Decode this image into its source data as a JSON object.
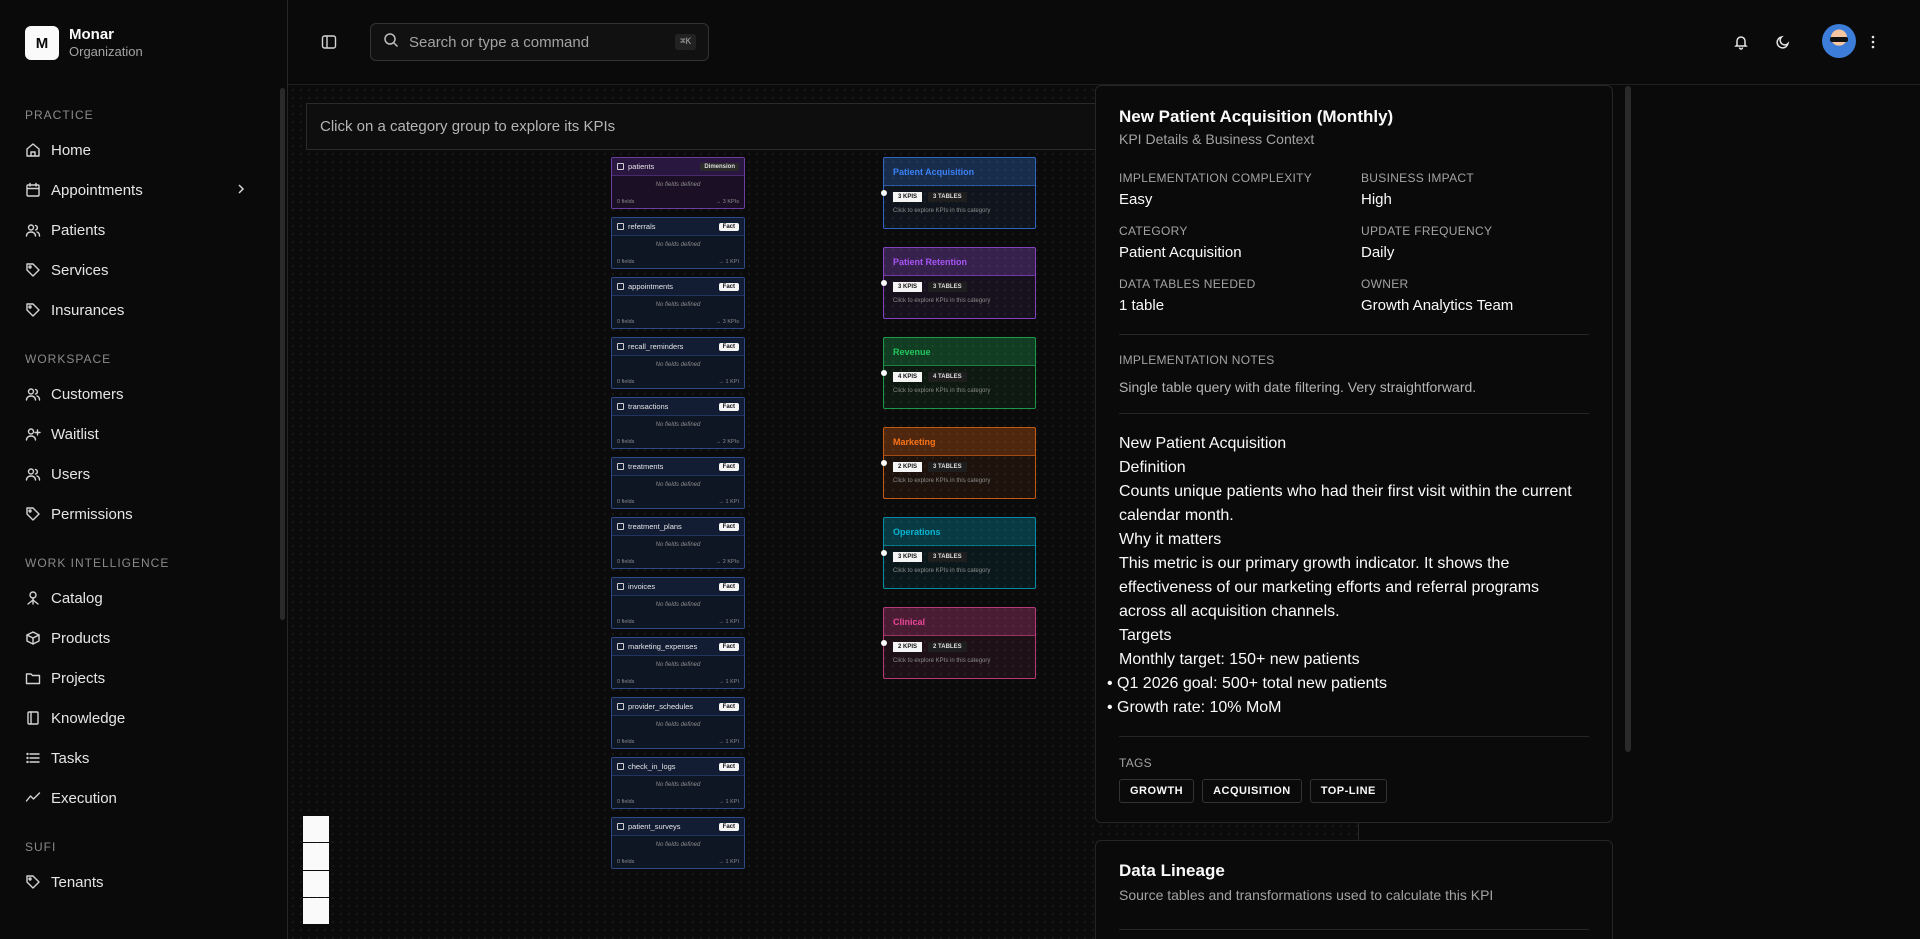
{
  "brand": {
    "logo_letter": "M",
    "name": "Monar",
    "subtitle": "Organization"
  },
  "sidebar": {
    "sections": [
      {
        "label": "PRACTICE",
        "items": [
          {
            "label": "Home",
            "icon": "home-icon"
          },
          {
            "label": "Appointments",
            "icon": "calendar-icon",
            "has_chevron": true
          },
          {
            "label": "Patients",
            "icon": "users-icon"
          },
          {
            "label": "Services",
            "icon": "tag-icon"
          },
          {
            "label": "Insurances",
            "icon": "tag-icon"
          }
        ]
      },
      {
        "label": "WORKSPACE",
        "items": [
          {
            "label": "Customers",
            "icon": "users-icon"
          },
          {
            "label": "Waitlist",
            "icon": "user-plus-icon"
          },
          {
            "label": "Users",
            "icon": "users-icon"
          },
          {
            "label": "Permissions",
            "icon": "tag-icon"
          }
        ]
      },
      {
        "label": "WORK INTELLIGENCE",
        "items": [
          {
            "label": "Catalog",
            "icon": "catalog-icon"
          },
          {
            "label": "Products",
            "icon": "box-icon"
          },
          {
            "label": "Projects",
            "icon": "folder-icon"
          },
          {
            "label": "Knowledge",
            "icon": "book-icon"
          },
          {
            "label": "Tasks",
            "icon": "list-icon"
          },
          {
            "label": "Execution",
            "icon": "activity-icon"
          }
        ]
      },
      {
        "label": "SUFI",
        "items": [
          {
            "label": "Tenants",
            "icon": "tag-icon"
          }
        ]
      }
    ]
  },
  "header": {
    "search_placeholder": "Search or type a command",
    "search_shortcut": "⌘K"
  },
  "canvas": {
    "hint": "Click on a category group to explore its KPIs",
    "tables": [
      {
        "name": "patients",
        "badge": "Dimension",
        "note": "No fields defined",
        "fields": "0 fields",
        "kpis": "→ 3 KPIs"
      },
      {
        "name": "referrals",
        "badge": "Fact",
        "note": "No fields defined",
        "fields": "0 fields",
        "kpis": "→ 1 KPI"
      },
      {
        "name": "appointments",
        "badge": "Fact",
        "note": "No fields defined",
        "fields": "0 fields",
        "kpis": "→ 3 KPIs"
      },
      {
        "name": "recall_reminders",
        "badge": "Fact",
        "note": "No fields defined",
        "fields": "0 fields",
        "kpis": "→ 1 KPI"
      },
      {
        "name": "transactions",
        "badge": "Fact",
        "note": "No fields defined",
        "fields": "0 fields",
        "kpis": "→ 2 KPIs"
      },
      {
        "name": "treatments",
        "badge": "Fact",
        "note": "No fields defined",
        "fields": "0 fields",
        "kpis": "→ 1 KPI"
      },
      {
        "name": "treatment_plans",
        "badge": "Fact",
        "note": "No fields defined",
        "fields": "0 fields",
        "kpis": "→ 2 KPIs"
      },
      {
        "name": "invoices",
        "badge": "Fact",
        "note": "No fields defined",
        "fields": "0 fields",
        "kpis": "→ 1 KPI"
      },
      {
        "name": "marketing_expenses",
        "badge": "Fact",
        "note": "No fields defined",
        "fields": "0 fields",
        "kpis": "→ 1 KPI"
      },
      {
        "name": "provider_schedules",
        "badge": "Fact",
        "note": "No fields defined",
        "fields": "0 fields",
        "kpis": "→ 1 KPI"
      },
      {
        "name": "check_in_logs",
        "badge": "Fact",
        "note": "No fields defined",
        "fields": "0 fields",
        "kpis": "→ 1 KPI"
      },
      {
        "name": "patient_surveys",
        "badge": "Fact",
        "note": "No fields defined",
        "fields": "0 fields",
        "kpis": "→ 1 KPI"
      }
    ],
    "categories": [
      {
        "name": "Patient Acquisition",
        "kpis": "3 KPIS",
        "tables": "3 TABLES",
        "note": "Click to explore KPIs in this category",
        "color": "#3b82f6"
      },
      {
        "name": "Patient Retention",
        "kpis": "3 KPIS",
        "tables": "3 TABLES",
        "note": "Click to explore KPIs in this category",
        "color": "#a855f7"
      },
      {
        "name": "Revenue",
        "kpis": "4 KPIS",
        "tables": "4 TABLES",
        "note": "Click to explore KPIs in this category",
        "color": "#22c55e"
      },
      {
        "name": "Marketing",
        "kpis": "2 KPIS",
        "tables": "3 TABLES",
        "note": "Click to explore KPIs in this category",
        "color": "#f97316"
      },
      {
        "name": "Operations",
        "kpis": "3 KPIS",
        "tables": "3 TABLES",
        "note": "Click to explore KPIs in this category",
        "color": "#06b6d4"
      },
      {
        "name": "Clinical",
        "kpis": "2 KPIS",
        "tables": "2 TABLES",
        "note": "Click to explore KPIs in this category",
        "color": "#ec4899"
      }
    ]
  },
  "kpi_panel": {
    "title": "New Patient Acquisition (Monthly)",
    "subtitle": "KPI Details & Business Context",
    "complexity_label": "IMPLEMENTATION COMPLEXITY",
    "complexity_value": "Easy",
    "impact_label": "BUSINESS IMPACT",
    "impact_value": "High",
    "category_label": "CATEGORY",
    "category_value": "Patient Acquisition",
    "frequency_label": "UPDATE FREQUENCY",
    "frequency_value": "Daily",
    "tables_label": "DATA TABLES NEEDED",
    "tables_value": "1 table",
    "owner_label": "OWNER",
    "owner_value": "Growth Analytics Team",
    "notes_label": "IMPLEMENTATION NOTES",
    "notes_value": "Single table query with date filtering. Very straightforward.",
    "md_title": "New Patient Acquisition",
    "md_definition_label": "Definition",
    "md_definition": "Counts unique patients who had their first visit within the current calendar month.",
    "md_why_label": "Why it matters",
    "md_why": "This metric is our primary growth indicator. It shows the effectiveness of our marketing efforts and referral programs across all acquisition channels.",
    "md_targets_label": "Targets",
    "md_target_monthly": "Monthly target: 150+ new patients",
    "md_bullets": [
      "Q1 2026 goal: 500+ total new patients",
      "Growth rate: 10% MoM"
    ],
    "tags_label": "TAGS",
    "tags": [
      "GROWTH",
      "ACQUISITION",
      "TOP-LINE"
    ]
  },
  "lineage_panel": {
    "title": "Data Lineage",
    "subtitle": "Source tables and transformations used to calculate this KPI"
  }
}
